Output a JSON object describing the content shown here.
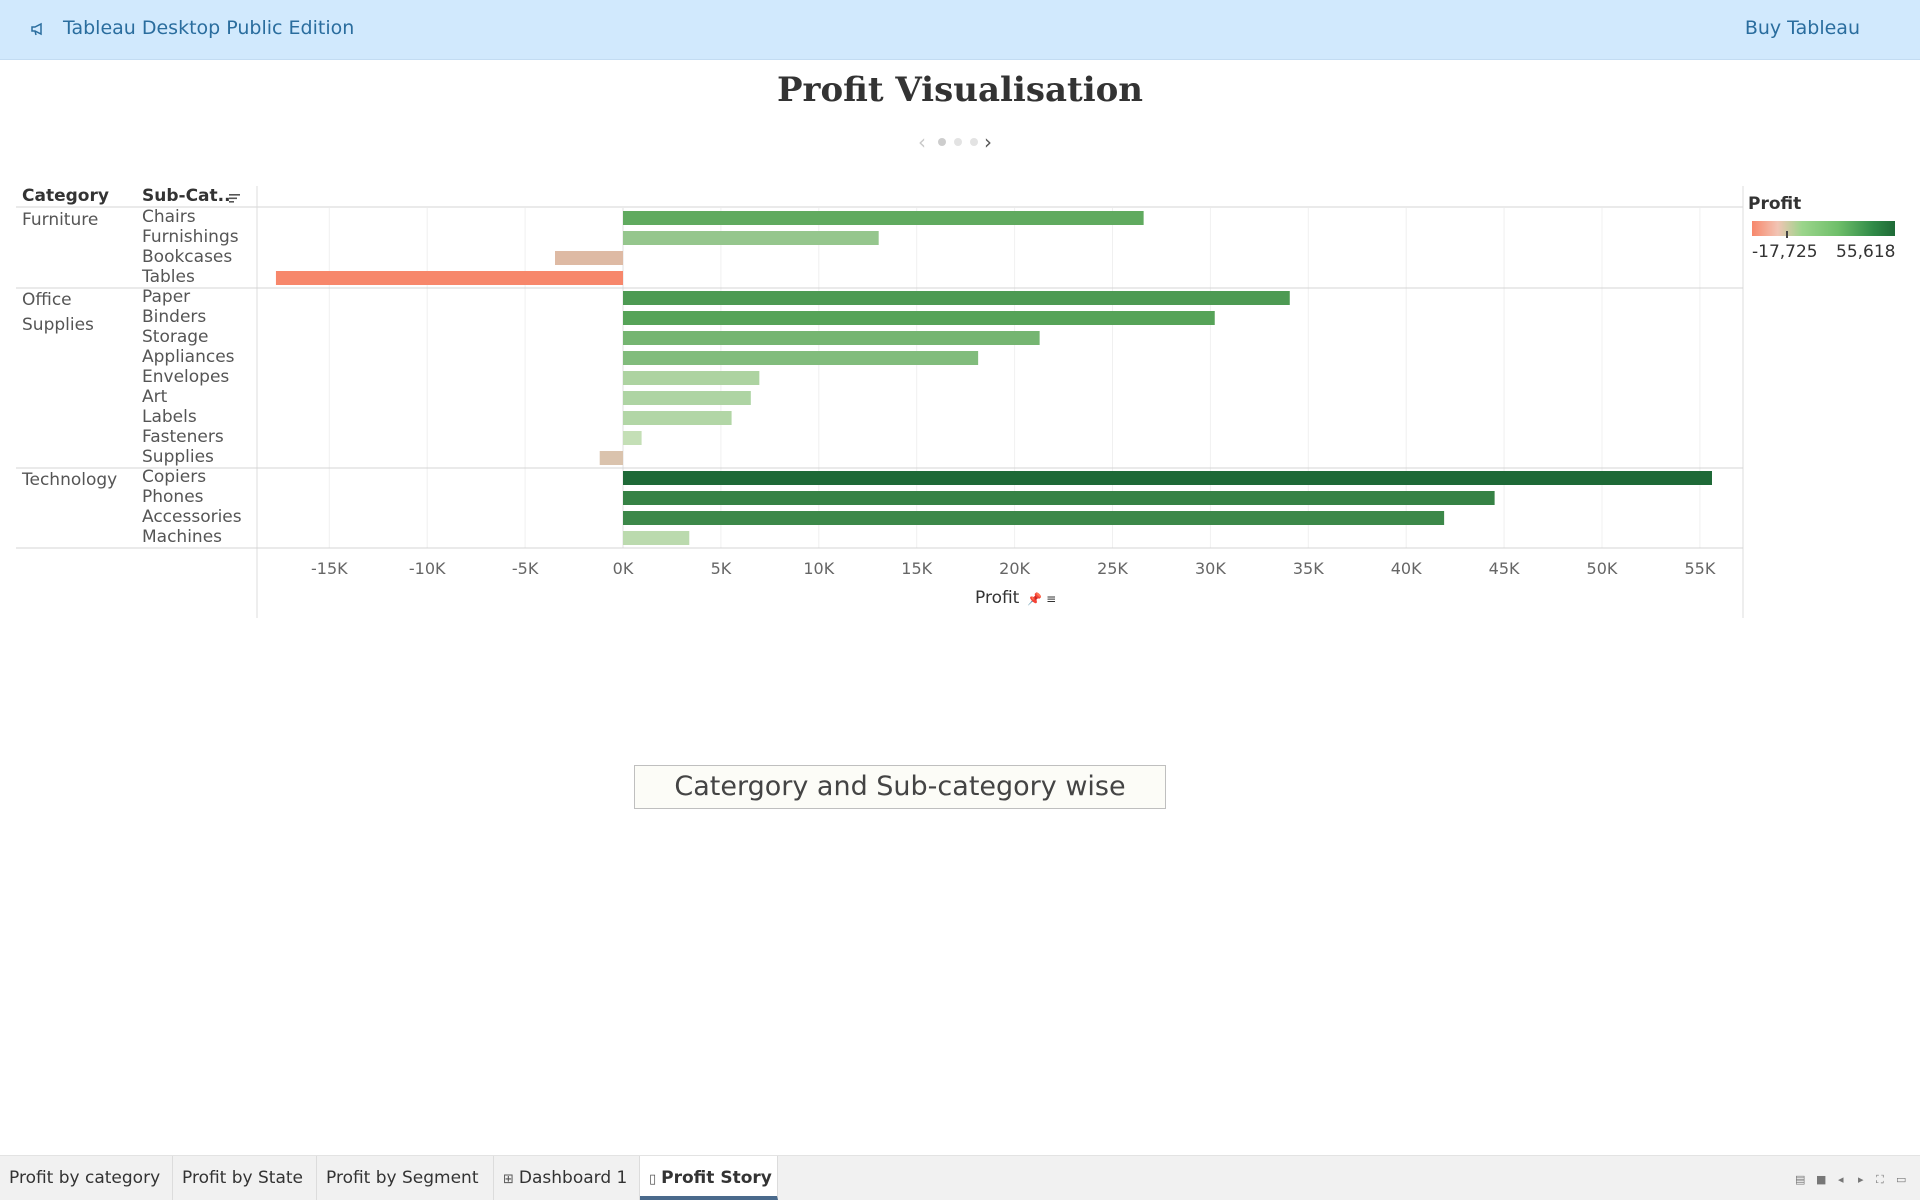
{
  "app": {
    "title": "Tableau Desktop Public Edition",
    "buy_label": "Buy Tableau"
  },
  "story": {
    "title": "Profit Visualisation",
    "pages": 3,
    "active_page": 1,
    "caption": "Catergory and Sub-category wise"
  },
  "table": {
    "category_header": "Category",
    "subcategory_header": "Sub-Cat.."
  },
  "legend": {
    "title": "Profit",
    "min_label": "-17,725",
    "max_label": "55,618"
  },
  "chart_data": {
    "type": "bar",
    "orientation": "horizontal",
    "title": "Profit Visualisation",
    "xlabel": "Profit",
    "xlim": [
      -18700,
      57000
    ],
    "x_ticks": [
      -15000,
      -10000,
      -5000,
      0,
      5000,
      10000,
      15000,
      20000,
      25000,
      30000,
      35000,
      40000,
      45000,
      50000,
      55000
    ],
    "x_tick_labels": [
      "-15K",
      "-10K",
      "-5K",
      "0K",
      "5K",
      "10K",
      "15K",
      "20K",
      "25K",
      "30K",
      "35K",
      "40K",
      "45K",
      "50K",
      "55K"
    ],
    "color_range": [
      -17725,
      55618
    ],
    "grid": true,
    "legend_position": "top-right",
    "groups": [
      {
        "category": "Furniture",
        "category_lines": [
          "Furniture"
        ],
        "items": [
          {
            "sub": "Chairs",
            "value": 26590
          },
          {
            "sub": "Furnishings",
            "value": 13059
          },
          {
            "sub": "Bookcases",
            "value": -3473
          },
          {
            "sub": "Tables",
            "value": -17725
          }
        ]
      },
      {
        "category": "Office Supplies",
        "category_lines": [
          "Office",
          "Supplies"
        ],
        "items": [
          {
            "sub": "Paper",
            "value": 34054
          },
          {
            "sub": "Binders",
            "value": 30222
          },
          {
            "sub": "Storage",
            "value": 21279
          },
          {
            "sub": "Appliances",
            "value": 18138
          },
          {
            "sub": "Envelopes",
            "value": 6964
          },
          {
            "sub": "Art",
            "value": 6528
          },
          {
            "sub": "Labels",
            "value": 5546
          },
          {
            "sub": "Fasteners",
            "value": 950
          },
          {
            "sub": "Supplies",
            "value": -1189
          }
        ]
      },
      {
        "category": "Technology",
        "category_lines": [
          "Technology"
        ],
        "items": [
          {
            "sub": "Copiers",
            "value": 55618
          },
          {
            "sub": "Phones",
            "value": 44516
          },
          {
            "sub": "Accessories",
            "value": 41937
          },
          {
            "sub": "Machines",
            "value": 3385
          }
        ]
      }
    ]
  },
  "tabs": [
    {
      "label": "Profit by category",
      "icon": ""
    },
    {
      "label": "Profit by State",
      "icon": ""
    },
    {
      "label": "Profit by Segment",
      "icon": ""
    },
    {
      "label": "Dashboard 1",
      "icon": "dashboard-icon"
    },
    {
      "label": "Profit Story",
      "icon": "story-icon",
      "active": true
    }
  ]
}
